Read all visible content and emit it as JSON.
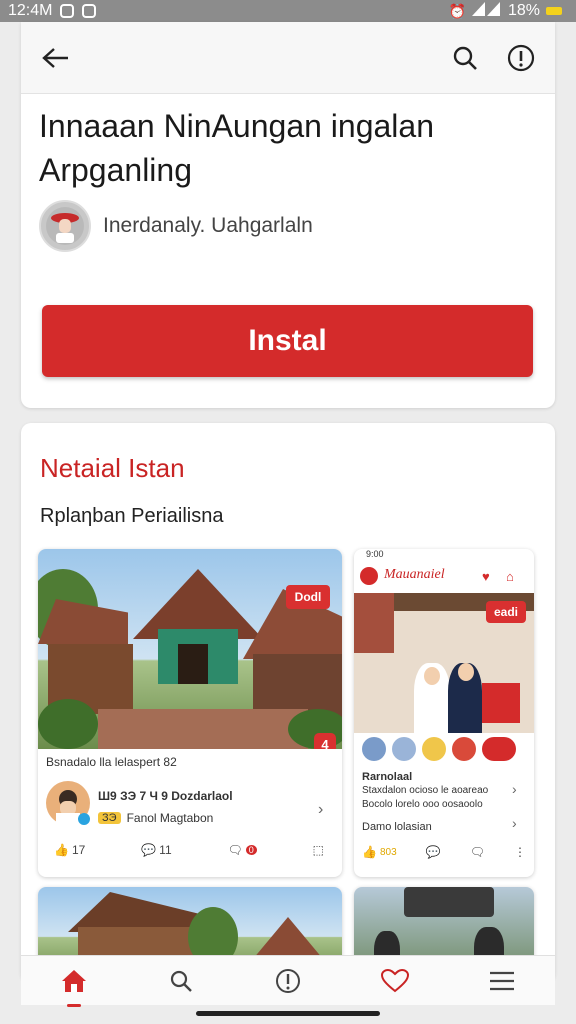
{
  "status": {
    "time": "12:4M",
    "battery": "18%"
  },
  "header": {
    "title_line1": "Innaaan NinAungan ingalan",
    "title_line2": "Arpganling",
    "developer": "Inerdanaly. Uahgarlaln",
    "install_label": "Instal"
  },
  "section": {
    "title": "Netaial Istan",
    "subtitle": "Rplaηban Periailisna"
  },
  "card1": {
    "tag": "Dodl",
    "badge": "4",
    "caption": "Bsnadalo lla lelaspert 82",
    "author": "Ш9 ЗЭ 7 Ч 9 Dozdarlaol",
    "sub_badge": "ЗЭ",
    "sub_label": "Fanol Magtabon",
    "likes": "17",
    "comments": "11",
    "shares": "0"
  },
  "card2": {
    "time": "9:00",
    "app_name": "Mauanaiel",
    "tag": "eadi",
    "heading": "Rarnolaal",
    "desc1": "Staxdalon ocioso le aoareao",
    "desc2": "Bocolo lorelo ooo oosaoolo",
    "footer_label": "Damo lolasian",
    "footer_count": "803"
  },
  "colors": {
    "accent": "#d42b2b",
    "accent_text": "#c92424"
  },
  "nav": {
    "items": [
      "home-icon",
      "search-icon",
      "info-icon",
      "heart-icon",
      "menu-icon"
    ]
  }
}
